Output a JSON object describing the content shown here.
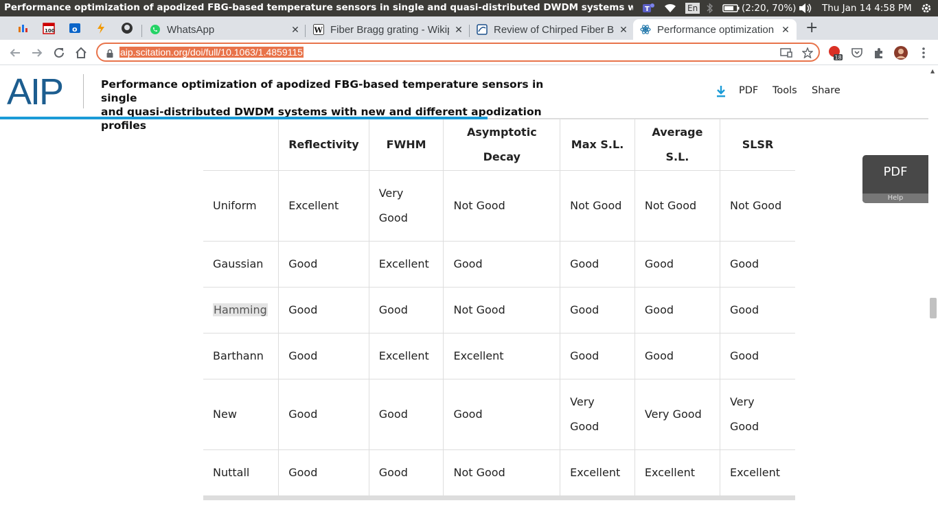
{
  "system": {
    "window_title": "Performance optimization of apodized FBG-based temperature sensors in single and quasi-distributed DWDM systems with new",
    "keyboard_layout": "En",
    "battery": "(2:20, 70%)",
    "datetime": "Thu Jan 14  4:58 PM"
  },
  "tabs": [
    {
      "label": "WhatsApp",
      "icon": "whatsapp-icon"
    },
    {
      "label": "Fiber Bragg grating - Wikipedia",
      "icon": "wikipedia-icon"
    },
    {
      "label": "Review of Chirped Fiber Bragg",
      "icon": "document-icon"
    },
    {
      "label": "Performance optimization",
      "icon": "scitation-icon",
      "active": true
    }
  ],
  "address_bar": {
    "url": "aip.scitation.org/doi/full/10.1063/1.4859115"
  },
  "extensions": {
    "badge_count": "18"
  },
  "header": {
    "logo": "AIP",
    "title_line1": "Performance optimization of apodized FBG-based temperature sensors in single",
    "title_line2": "and quasi-distributed DWDM systems with new and different apodization profiles",
    "pdf_label": "PDF",
    "tools_label": "Tools",
    "share_label": "Share"
  },
  "table": {
    "headers": [
      "",
      "Reflectivity",
      "FWHM",
      "Asymptotic Decay",
      "Max S.L.",
      "Average S.L.",
      "SLSR"
    ],
    "rows": [
      [
        "Uniform",
        "Excellent",
        "Very Good",
        "Not Good",
        "Not Good",
        "Not Good",
        "Not Good"
      ],
      [
        "Gaussian",
        "Good",
        "Excellent",
        "Good",
        "Good",
        "Good",
        "Good"
      ],
      [
        "Hamming",
        "Good",
        "Good",
        "Not Good",
        "Good",
        "Good",
        "Good"
      ],
      [
        "Barthann",
        "Good",
        "Excellent",
        "Excellent",
        "Good",
        "Good",
        "Good"
      ],
      [
        "New",
        "Good",
        "Good",
        "Good",
        "Very Good",
        "Very Good",
        "Very Good"
      ],
      [
        "Nuttall",
        "Good",
        "Good",
        "Not Good",
        "Excellent",
        "Excellent",
        "Excellent"
      ]
    ]
  },
  "pdf_widget": {
    "label": "PDF",
    "help": "Help"
  },
  "colors": {
    "accent": "#1a9bd7",
    "logo": "#1c5d8f",
    "omnibox_focus": "#e8734a"
  }
}
